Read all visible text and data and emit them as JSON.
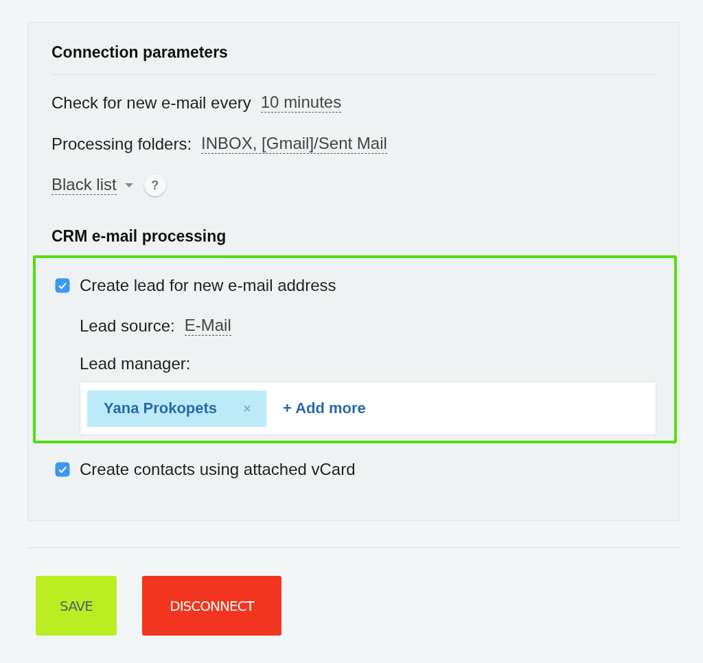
{
  "connection": {
    "title": "Connection parameters",
    "check_label": "Check for new e-mail every",
    "check_value": "10 minutes",
    "folders_label": "Processing folders:",
    "folders_value": "INBOX, [Gmail]/Sent Mail",
    "black_list": "Black list",
    "help": "?"
  },
  "crm": {
    "title": "CRM e-mail processing",
    "lead": {
      "label": "Create lead for new e-mail address",
      "checked": true,
      "highlighted": true,
      "source_label": "Lead source:",
      "source_value": "E-Mail",
      "manager_label": "Lead manager:",
      "managers": [
        {
          "name": "Yana Prokopets",
          "remove": "×"
        }
      ],
      "add_more": "+ Add more"
    },
    "vcard": {
      "label": "Create contacts using attached vCard",
      "checked": true
    }
  },
  "buttons": [
    {
      "label": "SAVE",
      "kind": "primary"
    },
    {
      "label": "DISCONNECT",
      "kind": "danger"
    }
  ]
}
